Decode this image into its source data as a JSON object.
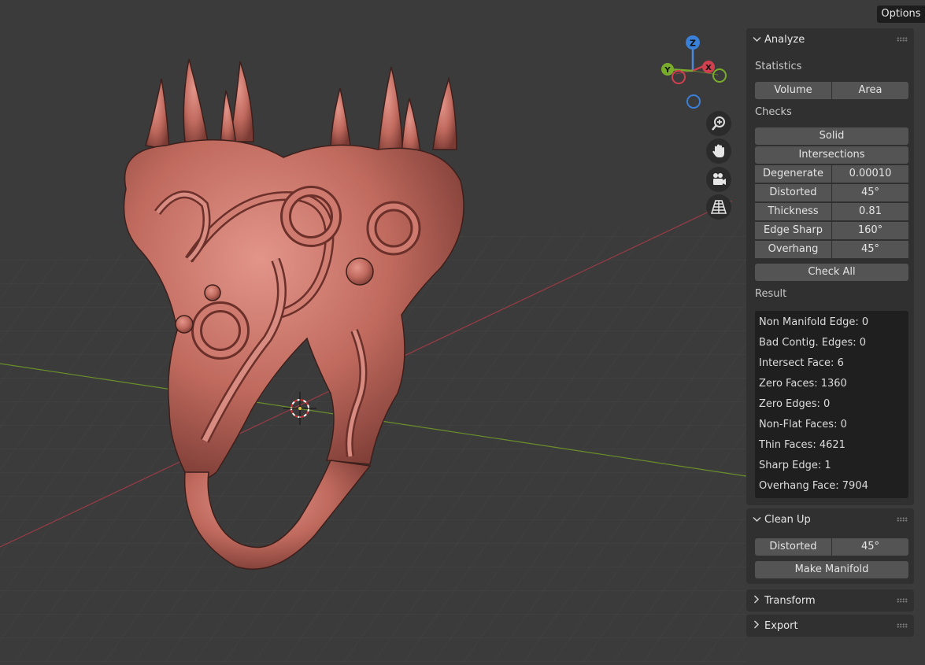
{
  "header": {
    "options_label": "Options"
  },
  "gizmo": {
    "x_label": "X",
    "y_label": "Y",
    "z_label": "Z"
  },
  "nav_icons": [
    "zoom-icon",
    "hand-pan-icon",
    "camera-icon",
    "perspective-grid-icon"
  ],
  "analyze": {
    "title": "Analyze",
    "statistics_label": "Statistics",
    "volume_label": "Volume",
    "area_label": "Area",
    "checks_label": "Checks",
    "solid_label": "Solid",
    "intersections_label": "Intersections",
    "checks": [
      {
        "name": "Degenerate",
        "value": "0.00010"
      },
      {
        "name": "Distorted",
        "value": "45°"
      },
      {
        "name": "Thickness",
        "value": "0.81"
      },
      {
        "name": "Edge Sharp",
        "value": "160°"
      },
      {
        "name": "Overhang",
        "value": "45°"
      }
    ],
    "check_all_label": "Check All",
    "result_label": "Result",
    "results": [
      "Non Manifold Edge: 0",
      "Bad Contig. Edges: 0",
      "Intersect Face: 6",
      "Zero Faces: 1360",
      "Zero Edges: 0",
      "Non-Flat Faces: 0",
      "Thin Faces: 4621",
      "Sharp Edge: 1",
      "Overhang Face: 7904"
    ]
  },
  "cleanup": {
    "title": "Clean Up",
    "distorted_label": "Distorted",
    "distorted_value": "45°",
    "make_manifold_label": "Make Manifold"
  },
  "transform": {
    "title": "Transform"
  },
  "export": {
    "title": "Export"
  },
  "colors": {
    "background": "#3b3b3b",
    "panel": "#303030",
    "button": "#545454",
    "model": "#c06a5e",
    "x_axis": "#b3434f",
    "y_axis": "#7fa830"
  }
}
